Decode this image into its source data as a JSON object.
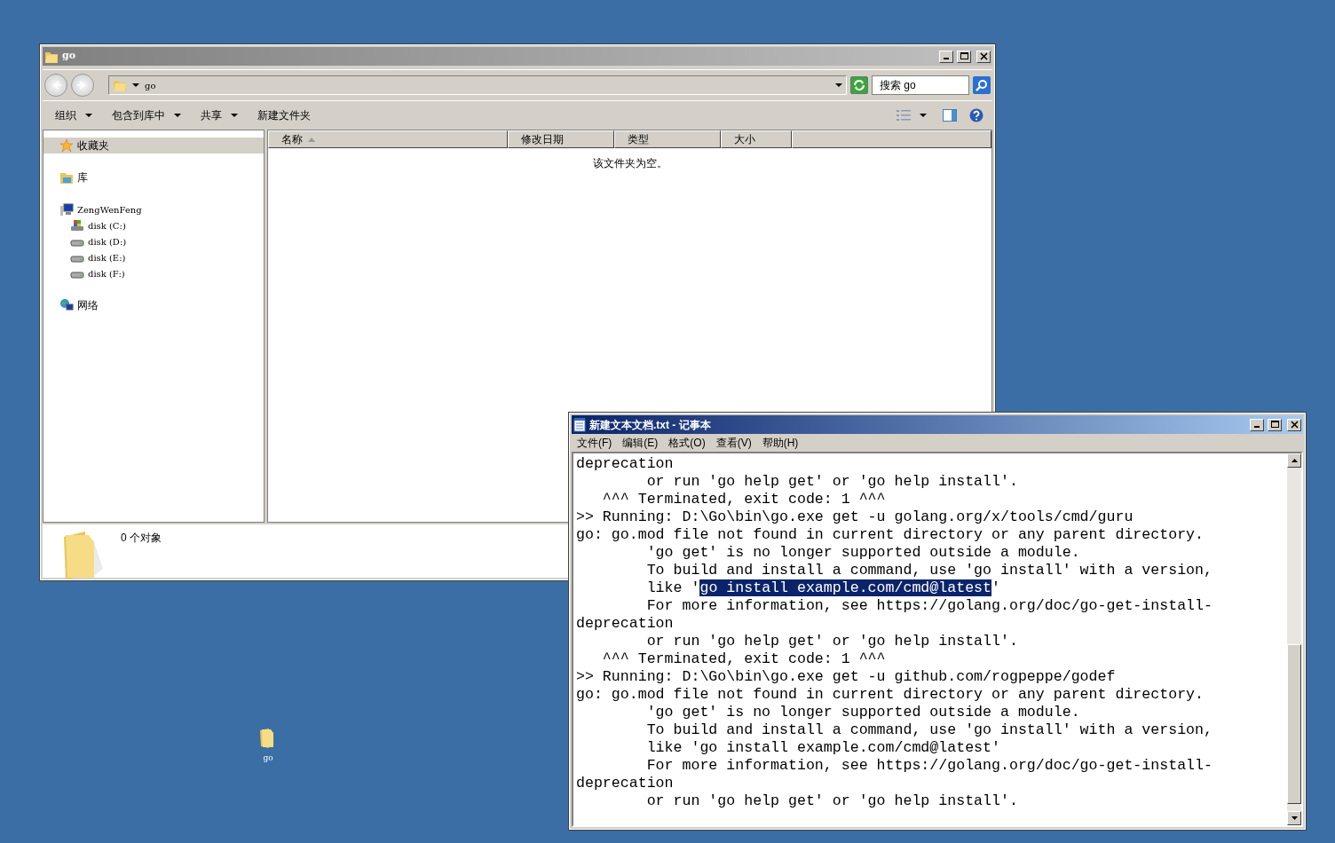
{
  "explorer": {
    "title": "go",
    "address": {
      "path": "go"
    },
    "search": {
      "placeholder": "搜索 go"
    },
    "toolbar": [
      {
        "label": "组织",
        "dropdown": true
      },
      {
        "label": "包含到库中",
        "dropdown": true
      },
      {
        "label": "共享",
        "dropdown": true
      },
      {
        "label": "新建文件夹",
        "dropdown": false
      }
    ],
    "nav": [
      {
        "label": "收藏夹",
        "kind": "star",
        "selected": true
      },
      {
        "label": "库",
        "kind": "library",
        "selected": false
      },
      {
        "label": "ZengWenFeng",
        "kind": "computer",
        "selected": false,
        "children": [
          {
            "label": "disk (C:)",
            "kind": "system-drive",
            "selected": false
          },
          {
            "label": "disk (D:)",
            "kind": "drive",
            "selected": false
          },
          {
            "label": "disk (E:)",
            "kind": "drive",
            "selected": false
          },
          {
            "label": "disk (F:)",
            "kind": "drive",
            "selected": false
          }
        ]
      },
      {
        "label": "网络",
        "kind": "network",
        "selected": false
      }
    ],
    "columns": [
      {
        "label": "名称",
        "sorted": true
      },
      {
        "label": "修改日期",
        "sorted": false
      },
      {
        "label": "类型",
        "sorted": false
      },
      {
        "label": "大小",
        "sorted": false
      }
    ],
    "empty_message": "该文件夹为空。",
    "details": {
      "count": "0 个对象"
    }
  },
  "desktop_icons": [
    {
      "label": "go"
    }
  ],
  "notepad": {
    "title": "新建文本文档.txt - 记事本",
    "menu": [
      "文件(F)",
      "编辑(E)",
      "格式(O)",
      "查看(V)",
      "帮助(H)"
    ],
    "lines": [
      {
        "text": "deprecation"
      },
      {
        "text": "        or run 'go help get' or 'go help install'."
      },
      {
        "text": "   ^^^ Terminated, exit code: 1 ^^^"
      },
      {
        "text": ">> Running: D:\\Go\\bin\\go.exe get -u golang.org/x/tools/cmd/guru"
      },
      {
        "text": "go: go.mod file not found in current directory or any parent directory."
      },
      {
        "text": "        'go get' is no longer supported outside a module."
      },
      {
        "text": "        To build and install a command, use 'go install' with a version,"
      },
      {
        "text": "        like '",
        "selected_text": "go install example.com/cmd@latest",
        "after": "'"
      },
      {
        "text": "        For more information, see https://golang.org/doc/go-get-install-"
      },
      {
        "text": "deprecation"
      },
      {
        "text": "        or run 'go help get' or 'go help install'."
      },
      {
        "text": "   ^^^ Terminated, exit code: 1 ^^^"
      },
      {
        "text": ">> Running: D:\\Go\\bin\\go.exe get -u github.com/rogpeppe/godef"
      },
      {
        "text": "go: go.mod file not found in current directory or any parent directory."
      },
      {
        "text": "        'go get' is no longer supported outside a module."
      },
      {
        "text": "        To build and install a command, use 'go install' with a version,"
      },
      {
        "text": "        like 'go install example.com/cmd@latest'"
      },
      {
        "text": "        For more information, see https://golang.org/doc/go-get-install-"
      },
      {
        "text": "deprecation"
      },
      {
        "text": "        or run 'go help get' or 'go help install'."
      }
    ]
  }
}
